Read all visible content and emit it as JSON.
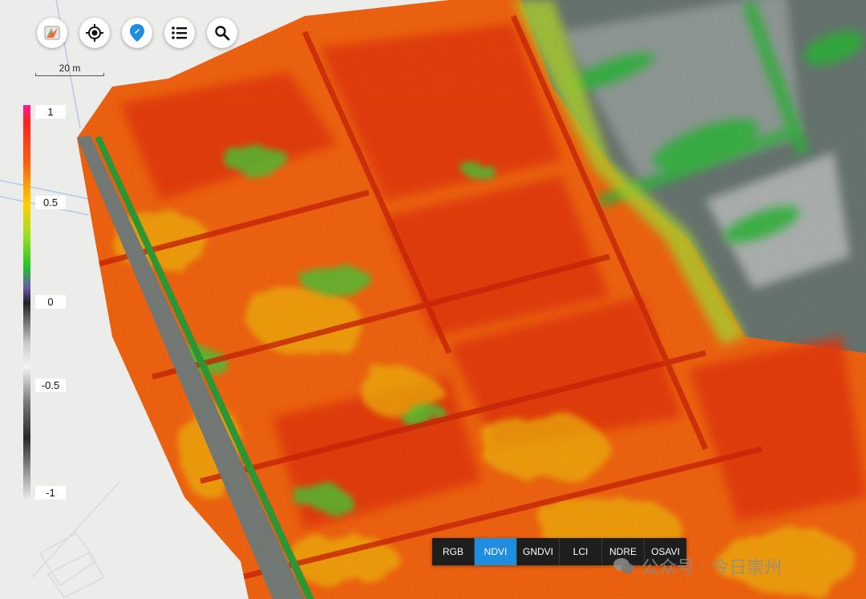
{
  "toolbar": {
    "buttons": [
      {
        "name": "layers-map-icon",
        "label": ""
      },
      {
        "name": "locate-icon",
        "label": ""
      },
      {
        "name": "marker-icon",
        "label": ""
      },
      {
        "name": "list-icon",
        "label": ""
      },
      {
        "name": "search-icon",
        "label": ""
      }
    ]
  },
  "scale": {
    "label": "20 m"
  },
  "legend": {
    "ticks": [
      "1",
      "0.5",
      "0",
      "-0.5",
      "-1"
    ]
  },
  "index_bar": {
    "items": [
      "RGB",
      "NDVI",
      "GNDVI",
      "LCI",
      "NDRE",
      "OSAVI"
    ],
    "active": "NDVI"
  },
  "watermark": {
    "text": "公众号 · 今日崇州"
  },
  "colors": {
    "accent": "#1f8de0",
    "high": "#ff4a10",
    "mid": "#ffd000",
    "low": "#26c630"
  }
}
